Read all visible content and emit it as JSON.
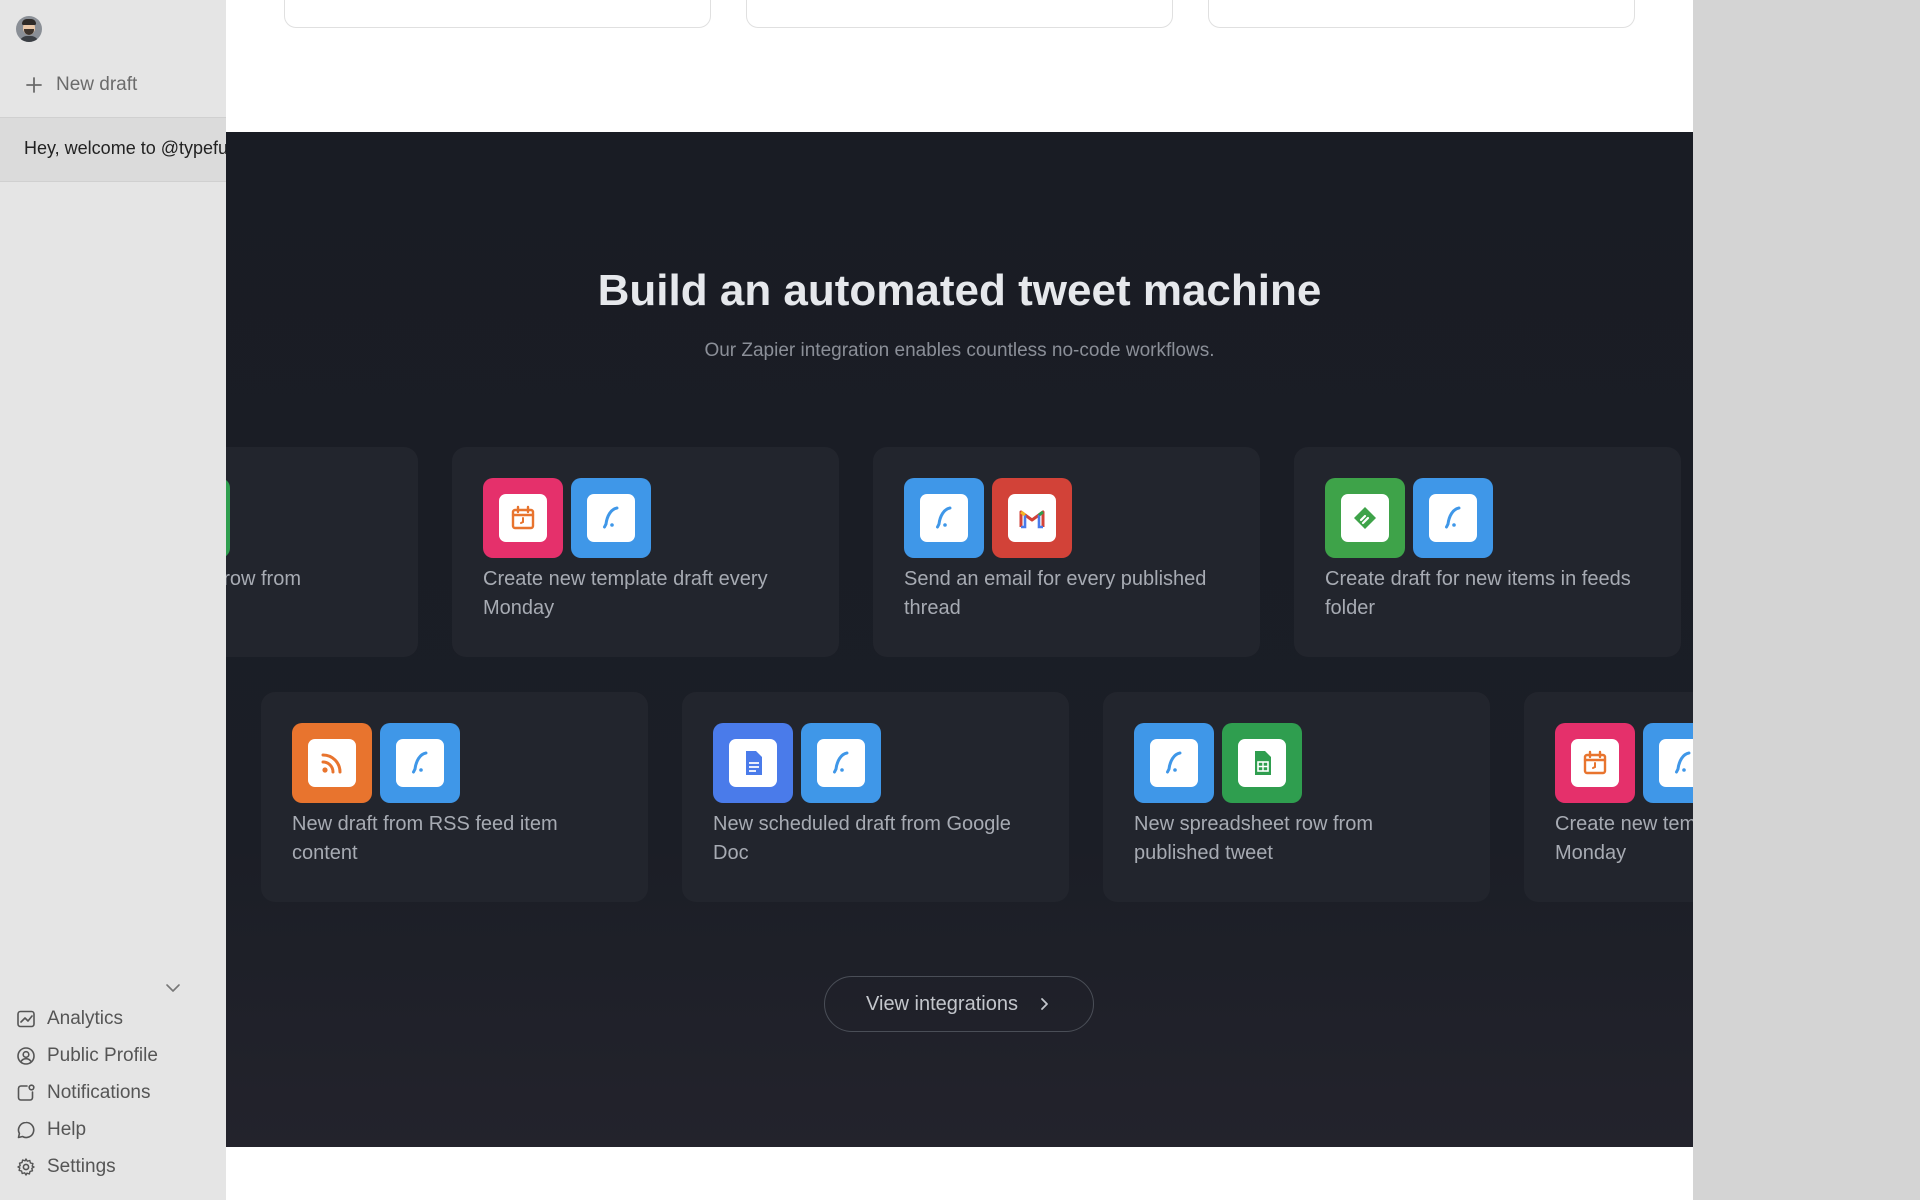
{
  "sidebar": {
    "new_draft_label": "New draft",
    "draft_item_text": "Hey, welcome to @typefully",
    "nav": [
      {
        "label": "Analytics",
        "icon": "chart-icon"
      },
      {
        "label": "Public Profile",
        "icon": "user-circle-icon"
      },
      {
        "label": "Notifications",
        "icon": "bell-square-icon"
      },
      {
        "label": "Help",
        "icon": "chat-bubble-icon"
      },
      {
        "label": "Settings",
        "icon": "gear-icon"
      }
    ]
  },
  "section": {
    "title": "Build an automated tweet machine",
    "subtitle": "Our Zapier integration enables countless no-code workflows.",
    "row1": [
      {
        "text": "New spreadsheet row from published tweet",
        "icons": [
          "typefully",
          "sheets"
        ]
      },
      {
        "text": "Create new template draft every Monday",
        "icons": [
          "calendar",
          "typefully"
        ]
      },
      {
        "text": "Send an email for every published thread",
        "icons": [
          "typefully",
          "gmail"
        ]
      },
      {
        "text": "Create draft for new items in feeds folder",
        "icons": [
          "feedly",
          "typefully"
        ]
      }
    ],
    "row2": [
      {
        "text": "New draft from RSS feed item content",
        "icons": [
          "rss",
          "typefully"
        ]
      },
      {
        "text": "New scheduled draft from Google Doc",
        "icons": [
          "docs",
          "typefully"
        ]
      },
      {
        "text": "New spreadsheet row from published tweet",
        "icons": [
          "typefully",
          "sheets"
        ]
      },
      {
        "text": "Create new template draft every Monday",
        "icons": [
          "calendar",
          "typefully"
        ]
      }
    ],
    "button_label": "View integrations"
  },
  "colors": {
    "typefully": "#3f97e8",
    "calendar": "#e5306b",
    "gmail": "#d24238",
    "feedly": "#3ea349",
    "rss": "#e8742e",
    "docs": "#4a7bea",
    "sheets": "#2f9e4f"
  }
}
